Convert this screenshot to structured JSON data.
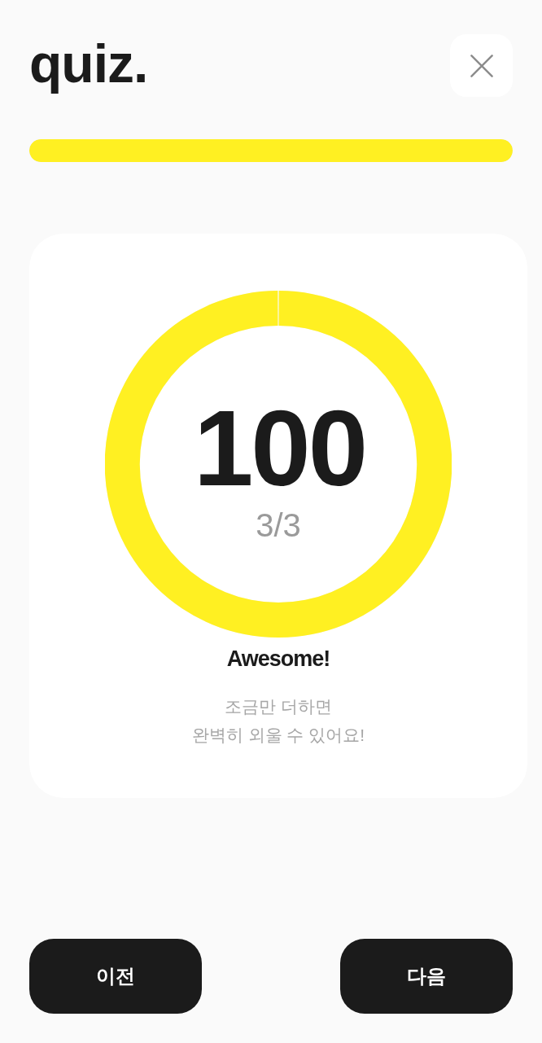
{
  "header": {
    "logo": "quiz."
  },
  "progress": {
    "level": 1
  },
  "result": {
    "level": 1,
    "score": "100",
    "count": "3/3",
    "title": "Awesome!",
    "message": [
      "조금만 더하면",
      "완벽히 외울 수 있어요!"
    ]
  },
  "buttons": [
    {
      "label": "이전"
    },
    {
      "label": "다음"
    }
  ]
}
